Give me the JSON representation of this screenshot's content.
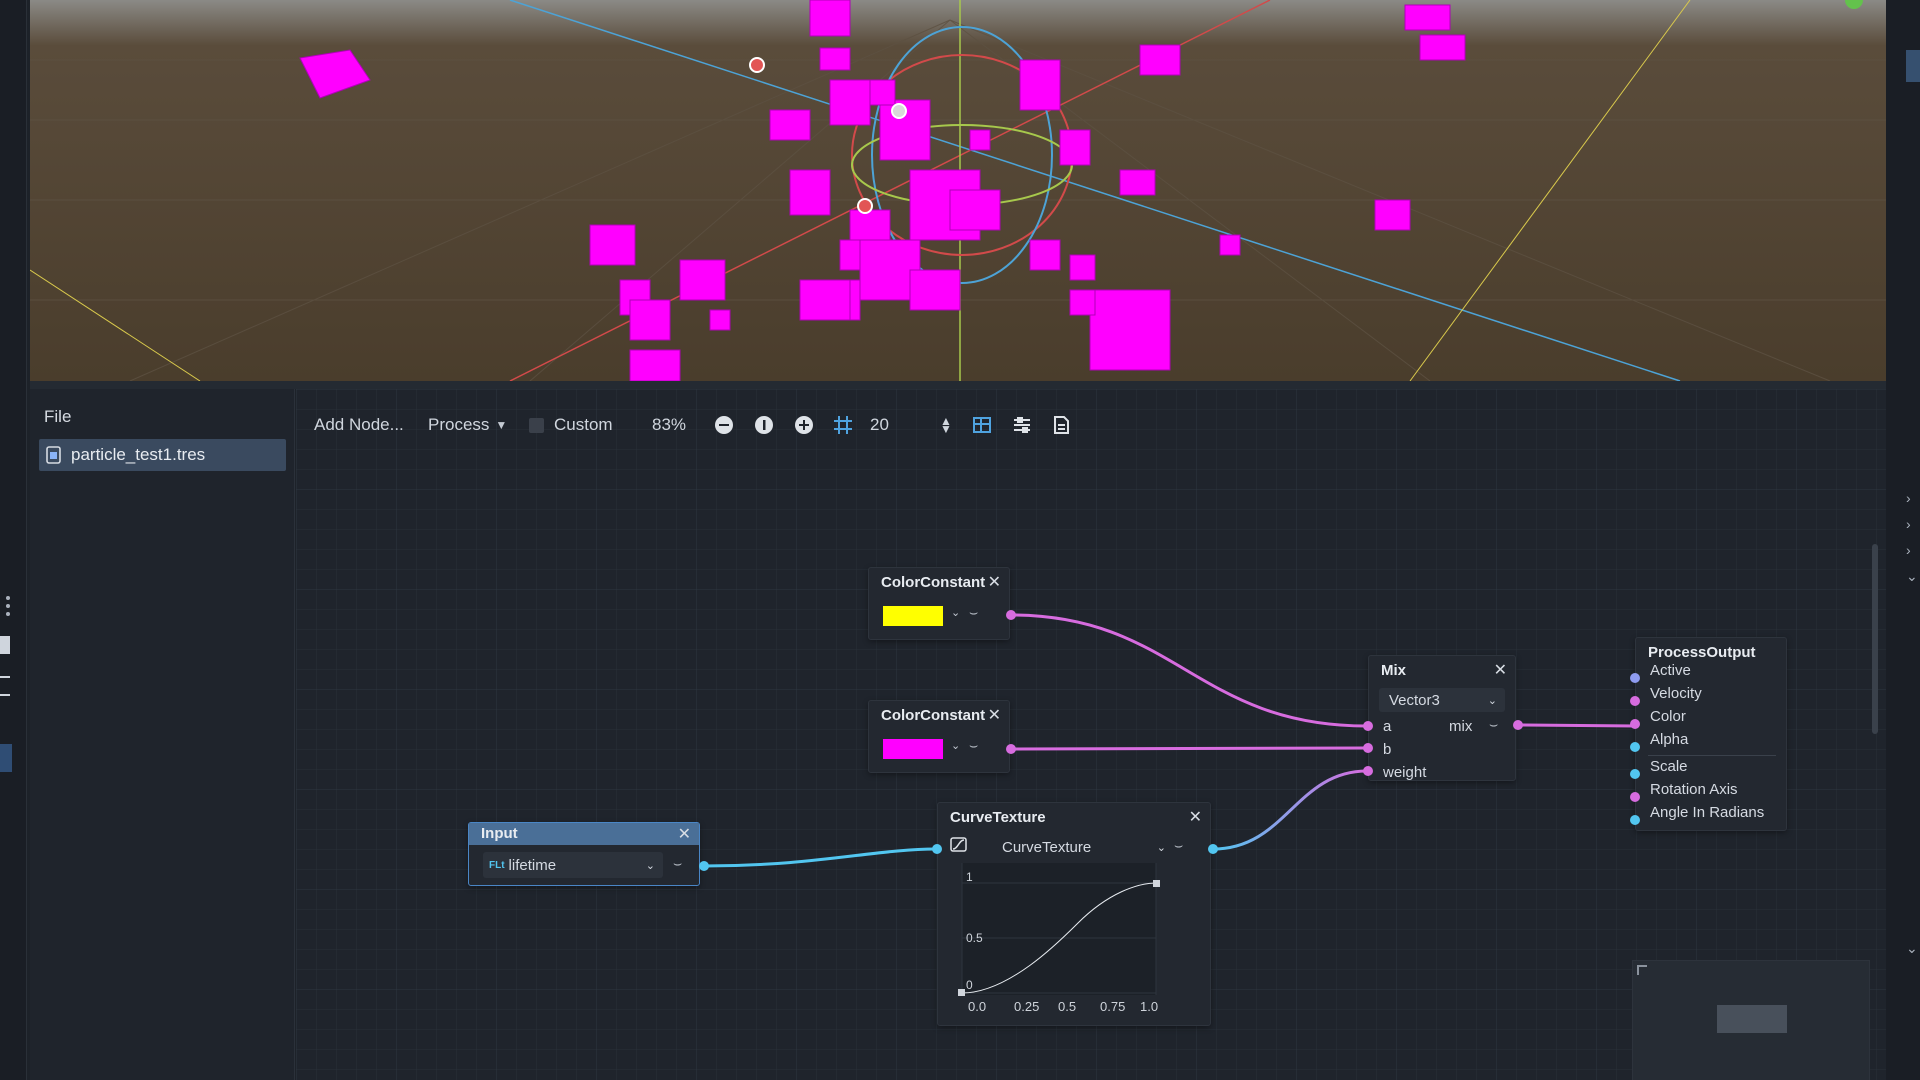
{
  "files": {
    "menu_label": "File",
    "items": [
      {
        "label": "particle_test1.tres"
      }
    ]
  },
  "toolbar": {
    "add_node_label": "Add Node...",
    "mode_label": "Process",
    "custom_label": "Custom",
    "zoom_label": "83%",
    "snap_value": "20"
  },
  "nodes": {
    "color_constant_1": {
      "title": "ColorConstant",
      "color": "#ffff00"
    },
    "color_constant_2": {
      "title": "ColorConstant",
      "color": "#ff00ff"
    },
    "mix": {
      "title": "Mix",
      "type": "Vector3",
      "inputs": [
        "a",
        "b",
        "weight"
      ],
      "output": "mix"
    },
    "process_output": {
      "title": "ProcessOutput",
      "inputs": [
        "Active",
        "Velocity",
        "Color",
        "Alpha",
        "Scale",
        "Rotation Axis",
        "Angle In Radians"
      ]
    },
    "input": {
      "title": "Input",
      "type_badge": "FLt",
      "value": "lifetime"
    },
    "curve_texture": {
      "title": "CurveTexture",
      "resource": "CurveTexture",
      "y_labels": [
        "1",
        "0.5",
        "0"
      ],
      "x_labels": [
        "0.0",
        "0.25",
        "0.5",
        "0.75",
        "1.0"
      ]
    }
  },
  "colors": {
    "accent": "#4fa3e0",
    "port_color": "#d76cdf",
    "port_float": "#52c6f0",
    "port_bool": "#8f9cf0",
    "particle": "#ff00ff"
  },
  "icons": [
    "file-resource-icon",
    "zoom-out-icon",
    "zoom-reset-icon",
    "zoom-in-icon",
    "snap-grid-icon",
    "minimap-icon",
    "arrange-icon",
    "code-icon",
    "close-icon",
    "chevron-down-icon",
    "curve-icon"
  ]
}
